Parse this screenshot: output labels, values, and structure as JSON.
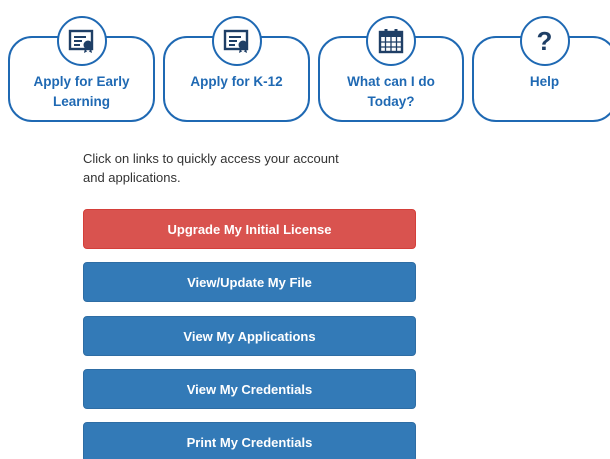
{
  "tiles": [
    {
      "label_line1": "Apply for Early",
      "label_line2": "Learning",
      "icon": "certificate-icon"
    },
    {
      "label_line1": "Apply for K-12",
      "label_line2": "",
      "icon": "certificate-icon"
    },
    {
      "label_line1": "What can I do",
      "label_line2": "Today?",
      "icon": "calendar-icon"
    },
    {
      "label_line1": "Help",
      "label_line2": "",
      "icon": "help-icon",
      "glyph": "?"
    }
  ],
  "intro": {
    "line1": "Click on links to quickly access your account",
    "line2": "and applications."
  },
  "actions": [
    {
      "label": "Upgrade My Initial License",
      "color": "#d9534f"
    },
    {
      "label": "View/Update My File",
      "color": "#337ab7"
    },
    {
      "label": "View My Applications",
      "color": "#337ab7"
    },
    {
      "label": "View My Credentials",
      "color": "#337ab7"
    },
    {
      "label": "Print My Credentials",
      "color": "#337ab7"
    }
  ],
  "theme": {
    "accent": "#1f69b3",
    "danger": "#d9534f",
    "primary": "#337ab7"
  }
}
